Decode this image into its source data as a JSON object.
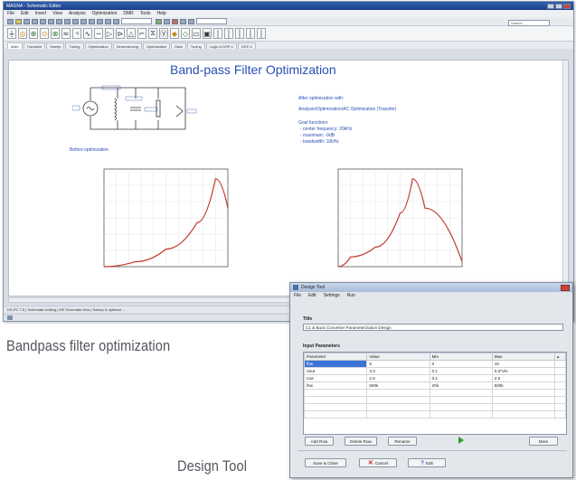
{
  "app": {
    "title": "MAGNA - Schematic Editor",
    "menu": [
      "File",
      "Edit",
      "Insert",
      "View",
      "Analysis",
      "Optimization",
      "DMR",
      "Tools",
      "Help"
    ],
    "toolbar_search": "Search",
    "tabs": [
      "Main",
      "Transient",
      "Sweep",
      "Tuning",
      "Optimization",
      "Dimensioning",
      "Optimization",
      "Data",
      "Tuning",
      "Logic & DSP-1",
      "DSP-2"
    ],
    "status_text": "DS-PC 7.5 | Schematic editing | MS Schematic flow | Sweep & optimize ...",
    "document": {
      "title": "Band-pass Filter Optimization",
      "before_label": "Before optimization",
      "after_heading": "After optimization with:",
      "after_method": "Analysis\\Optimization\\AC Optimization (Transfer)",
      "goal_heading": "Goal functions:",
      "goals": [
        "- center frequency: 20kHz",
        "- maximum: -9dB",
        "- bandwidth: 10kHz"
      ]
    }
  },
  "captions": {
    "left": "Bandpass filter optimization",
    "right": "Design Tool"
  },
  "dialog": {
    "title": "Design Tool",
    "menu": [
      "File",
      "Edit",
      "Settings",
      "Run"
    ],
    "title_label": "Title",
    "title_value": "C1 & Buck Converter Parameterization Design",
    "params_label": "Input Parameters",
    "columns": [
      "Parameter",
      "Value",
      "Min",
      "Max"
    ],
    "rows": [
      [
        "fbw",
        "5",
        "0",
        "10"
      ],
      [
        "Vout",
        "3.3",
        "0.1",
        "0.6*Vin"
      ],
      [
        "Iout",
        "2.5",
        "0.1",
        "2.5"
      ],
      [
        "fsw",
        "500k",
        "20k",
        "500k"
      ]
    ],
    "buttons": {
      "add_row": "Add Row",
      "delete_row": "Delete Row",
      "rename": "Rename",
      "more": "More",
      "save_close": "Save & Close",
      "cancel": "Cancel",
      "edit": "Edit"
    }
  },
  "chart_data": [
    {
      "type": "line",
      "x": [
        0,
        50,
        100,
        150,
        180,
        200
      ],
      "y": [
        0,
        5,
        18,
        45,
        90,
        60
      ],
      "colors": {
        "line": "#c0392b"
      }
    },
    {
      "type": "line",
      "x": [
        0,
        20,
        60,
        100,
        120,
        140,
        200
      ],
      "y": [
        0,
        10,
        20,
        55,
        90,
        60,
        5
      ],
      "colors": {
        "line": "#c0392b"
      }
    }
  ]
}
